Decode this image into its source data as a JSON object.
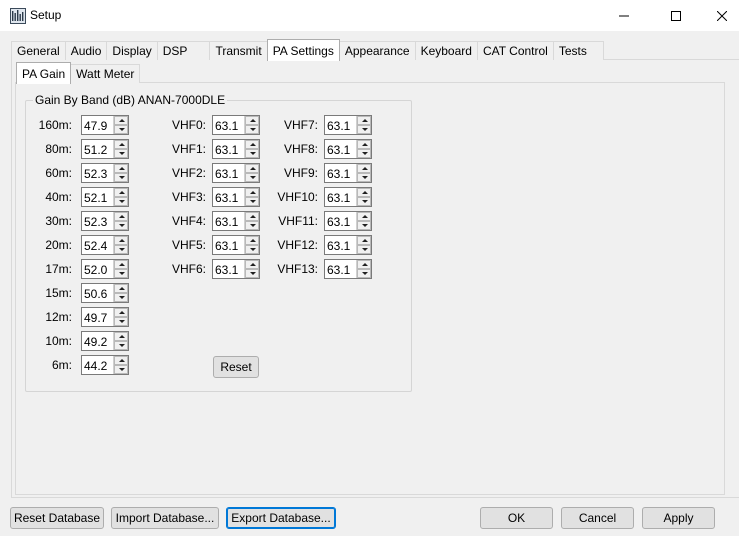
{
  "window": {
    "title": "Setup"
  },
  "tabs": [
    {
      "label": "General"
    },
    {
      "label": "Audio"
    },
    {
      "label": "Display"
    },
    {
      "label": "DSP"
    },
    {
      "label": "Transmit"
    },
    {
      "label": "PA Settings",
      "active": true
    },
    {
      "label": "Appearance"
    },
    {
      "label": "Keyboard"
    },
    {
      "label": "CAT Control"
    },
    {
      "label": "Tests"
    }
  ],
  "subtabs": [
    {
      "label": "PA Gain",
      "active": true
    },
    {
      "label": "Watt Meter"
    }
  ],
  "group": {
    "title": "Gain By Band (dB) ANAN-7000DLE"
  },
  "hf_bands": [
    {
      "label": "160m:",
      "value": "47.9"
    },
    {
      "label": "80m:",
      "value": "51.2"
    },
    {
      "label": "60m:",
      "value": "52.3"
    },
    {
      "label": "40m:",
      "value": "52.1"
    },
    {
      "label": "30m:",
      "value": "52.3"
    },
    {
      "label": "20m:",
      "value": "52.4"
    },
    {
      "label": "17m:",
      "value": "52.0"
    },
    {
      "label": "15m:",
      "value": "50.6"
    },
    {
      "label": "12m:",
      "value": "49.7"
    },
    {
      "label": "10m:",
      "value": "49.2"
    },
    {
      "label": "6m:",
      "value": "44.2"
    }
  ],
  "vhf_col1": [
    {
      "label": "VHF0:",
      "value": "63.1"
    },
    {
      "label": "VHF1:",
      "value": "63.1"
    },
    {
      "label": "VHF2:",
      "value": "63.1"
    },
    {
      "label": "VHF3:",
      "value": "63.1"
    },
    {
      "label": "VHF4:",
      "value": "63.1"
    },
    {
      "label": "VHF5:",
      "value": "63.1"
    },
    {
      "label": "VHF6:",
      "value": "63.1"
    }
  ],
  "vhf_col2": [
    {
      "label": "VHF7:",
      "value": "63.1"
    },
    {
      "label": "VHF8:",
      "value": "63.1"
    },
    {
      "label": "VHF9:",
      "value": "63.1"
    },
    {
      "label": "VHF10:",
      "value": "63.1"
    },
    {
      "label": "VHF11:",
      "value": "63.1"
    },
    {
      "label": "VHF12:",
      "value": "63.1"
    },
    {
      "label": "VHF13:",
      "value": "63.1"
    }
  ],
  "reset_label": "Reset",
  "footer": {
    "reset_db": "Reset Database",
    "import_db": "Import Database...",
    "export_db": "Export Database...",
    "ok": "OK",
    "cancel": "Cancel",
    "apply": "Apply"
  }
}
